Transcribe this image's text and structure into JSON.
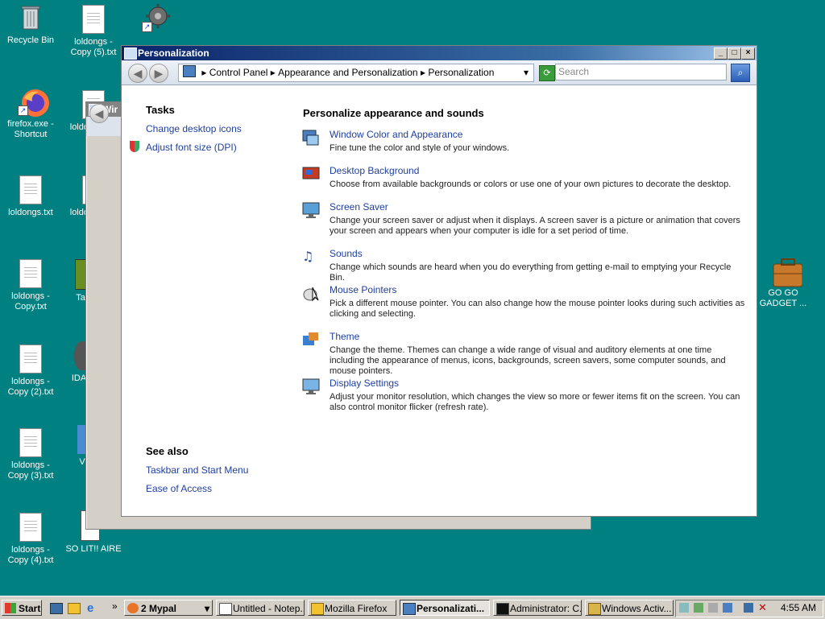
{
  "desktop": {
    "icons": [
      {
        "label": "Recycle Bin",
        "icon": "recycle-bin-icon"
      },
      {
        "label": "loldongs - Copy (5).txt",
        "icon": "text-file-icon"
      },
      {
        "label": "firefox.exe - Shortcut",
        "icon": "firefox-icon"
      },
      {
        "label": "loldongs.txt",
        "icon": "text-file-icon"
      },
      {
        "label": "loldongs - Copy.txt",
        "icon": "text-file-icon"
      },
      {
        "label": "loldongs - Copy (2).txt",
        "icon": "text-file-icon"
      },
      {
        "label": "loldongs - Copy (3).txt",
        "icon": "text-file-icon"
      },
      {
        "label": "loldongs - Copy (4).txt",
        "icon": "text-file-icon"
      },
      {
        "label": "loldo",
        "icon": "text-file-icon"
      },
      {
        "label": "loldo",
        "icon": "text-file-icon"
      },
      {
        "label": "Ta",
        "icon": "app-icon"
      },
      {
        "label": "IDA",
        "icon": "app-icon"
      },
      {
        "label": "V",
        "icon": "app-icon"
      },
      {
        "label": "SO LIT!! AIRE",
        "icon": "app-icon"
      },
      {
        "label": "GO GO GADGET ...",
        "icon": "briefcase-icon"
      }
    ]
  },
  "back_window": {
    "title": "Wir"
  },
  "window": {
    "title": "Personalization",
    "controls": {
      "minimize": "_",
      "maximize": "□",
      "close": "×"
    },
    "breadcrumb": [
      "Control Panel",
      "Appearance and Personalization",
      "Personalization"
    ],
    "search_placeholder": "Search",
    "tasks": {
      "heading": "Tasks",
      "links": [
        "Change desktop icons",
        "Adjust font size (DPI)"
      ]
    },
    "see_also": {
      "heading": "See also",
      "links": [
        "Taskbar and Start Menu",
        "Ease of Access"
      ]
    },
    "main_heading": "Personalize appearance and sounds",
    "items": [
      {
        "title": "Window Color and Appearance",
        "desc": "Fine tune the color and style of your windows.",
        "icon": "window-color-icon"
      },
      {
        "title": "Desktop Background",
        "desc": "Choose from available backgrounds or colors or use one of your own pictures to decorate the desktop.",
        "icon": "desktop-background-icon"
      },
      {
        "title": "Screen Saver",
        "desc": "Change your screen saver or adjust when it displays. A screen saver is a picture or animation that covers your screen and appears when your computer is idle for a set period of time.",
        "icon": "screen-saver-icon"
      },
      {
        "title": "Sounds",
        "desc": "Change which sounds are heard when you do everything from getting e-mail to emptying your Recycle Bin.",
        "icon": "sounds-icon"
      },
      {
        "title": "Mouse Pointers",
        "desc": "Pick a different mouse pointer. You can also change how the mouse pointer looks during such activities as clicking and selecting.",
        "icon": "mouse-pointer-icon"
      },
      {
        "title": "Theme",
        "desc": "Change the theme. Themes can change a wide range of visual and auditory elements at one time including the appearance of menus, icons, backgrounds, screen savers, some computer sounds, and mouse pointers.",
        "icon": "theme-icon"
      },
      {
        "title": "Display Settings",
        "desc": "Adjust your monitor resolution, which changes the view so more or fewer items fit on the screen. You can also control monitor flicker (refresh rate).",
        "icon": "display-settings-icon"
      }
    ]
  },
  "taskbar": {
    "start": "Start",
    "buttons": [
      {
        "label": "2 Mypal"
      },
      {
        "label": "Untitled - Notep..."
      },
      {
        "label": "Mozilla Firefox"
      },
      {
        "label": "Personalizati..."
      },
      {
        "label": "Administrator: C..."
      },
      {
        "label": "Windows Activ..."
      }
    ],
    "clock": "4:55 AM"
  },
  "colors": {
    "desktop": "#008080",
    "title_start": "#0a246a",
    "title_end": "#a6caf0",
    "link": "#1f3f9f"
  }
}
